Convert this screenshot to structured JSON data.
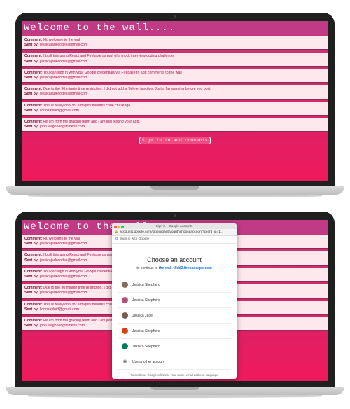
{
  "app": {
    "title": "Welcome to the wall....",
    "sign_in_label": "Sign in to add comments"
  },
  "labels": {
    "comment": "Comment:",
    "sent_by": "Sent by:"
  },
  "comments": [
    {
      "comment": "Hi, welcome to the wall",
      "sender": "jessicajadecodes@gmail.com"
    },
    {
      "comment": "I built this using React and Firebase as part of a mock interview coding challenge",
      "sender": "jessicajadecodes@gmail.com"
    },
    {
      "comment": "You can sign in with your Google credentials via Firebase to add comments to the wall",
      "sender": "jessicajadecodes@gmail.com"
    },
    {
      "comment": "Due to the 90 minute time restriction, I did not add a 'delete' function. Just a fair warning before you post!",
      "sender": "jessicajadecodes@gmail.com"
    },
    {
      "comment": "This is really cool for a mighty minutes code challenge.",
      "sender": "lloriosayloid@gmail.com"
    },
    {
      "comment": "Hi! I'm from the grading team and I am just testing your app.",
      "sender": "john.wagoner@thinkful.com"
    }
  ],
  "popup": {
    "window_title": "Sign in – Google Accounts",
    "url": "accounts.google.com/signin/oauth/oauthchooseaccount?client_id=1...",
    "google_bar": "Sign in with Google",
    "heading": "Choose an account",
    "continue_prefix": "to continue to",
    "continue_target": "the-wall-49dd2.firebaseapp.com",
    "accounts": [
      {
        "name": "Jessica Shepherd",
        "color": "#8a6a5a"
      },
      {
        "name": "Jessica Shepherd",
        "color": "#b0507a"
      },
      {
        "name": "Jessica Jade",
        "color": "#7a5a4a"
      },
      {
        "name": "Jessica Shepherd",
        "color": "#d84315"
      },
      {
        "name": "Jessica Shepherd",
        "color": "#00796b"
      }
    ],
    "use_another": "Use another account",
    "footer": "To continue, Google will share your name, email address, language"
  },
  "colors": {
    "header": "#c13a86",
    "screen_bottom": "#ef1a5d",
    "comment_bg": "#fde8ee"
  }
}
